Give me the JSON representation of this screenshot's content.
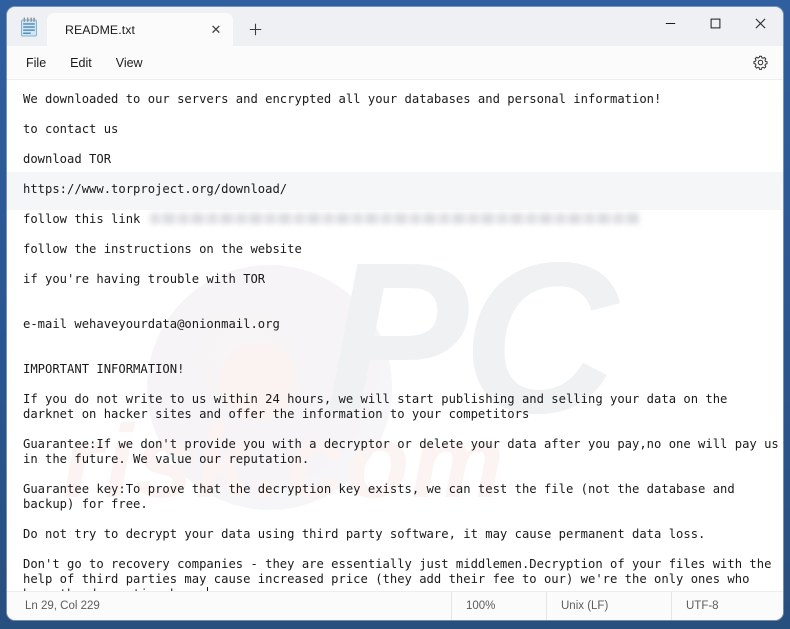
{
  "window": {
    "frame_color": "#2a5690",
    "app_icon": "notepad-icon"
  },
  "tabs": [
    {
      "label": "README.txt",
      "close_glyph": "✕"
    }
  ],
  "tabbar": {
    "new_tab_glyph": "＋",
    "new_tab_name": "new-tab-button"
  },
  "window_controls": {
    "minimize": "minimize",
    "maximize": "maximize",
    "close": "close"
  },
  "menubar": {
    "items": [
      {
        "label": "File"
      },
      {
        "label": "Edit"
      },
      {
        "label": "View"
      }
    ],
    "settings_icon": "gear-icon"
  },
  "document": {
    "lines": [
      "We downloaded to our servers and encrypted all your databases and personal information!",
      "",
      "to contact us",
      "",
      "download TOR",
      "",
      "https://www.torproject.org/download/",
      "",
      "follow this link ",
      "",
      "follow the instructions on the website",
      "",
      "if you're having trouble with TOR",
      "",
      "",
      "e-mail wehaveyourdata@onionmail.org",
      "",
      "",
      "IMPORTANT INFORMATION!",
      "",
      "If you do not write to us within 24 hours, we will start publishing and selling your data on the darknet on hacker sites and offer the information to your competitors",
      "",
      "Guarantee:If we don't provide you with a decryptor or delete your data after you pay,no one will pay us in the future. We value our reputation.",
      "",
      "Guarantee key:To prove that the decryption key exists, we can test the file (not the database and backup) for free.",
      "",
      "Do not try to decrypt your data using third party software, it may cause permanent data loss.",
      "",
      "Don't go to recovery companies - they are essentially just middlemen.Decryption of your files with the help of third parties may cause increased price (they add their fee to our) we're the only ones who have the decryption keys."
    ],
    "redacted_link_line_index": 8,
    "redacted_link_label": "follow this link"
  },
  "watermark": {
    "logo_text": "PC",
    "site_text": "risk.com"
  },
  "statusbar": {
    "position": "Ln 29, Col 229",
    "zoom": "100%",
    "line_ending": "Unix (LF)",
    "encoding": "UTF-8"
  }
}
